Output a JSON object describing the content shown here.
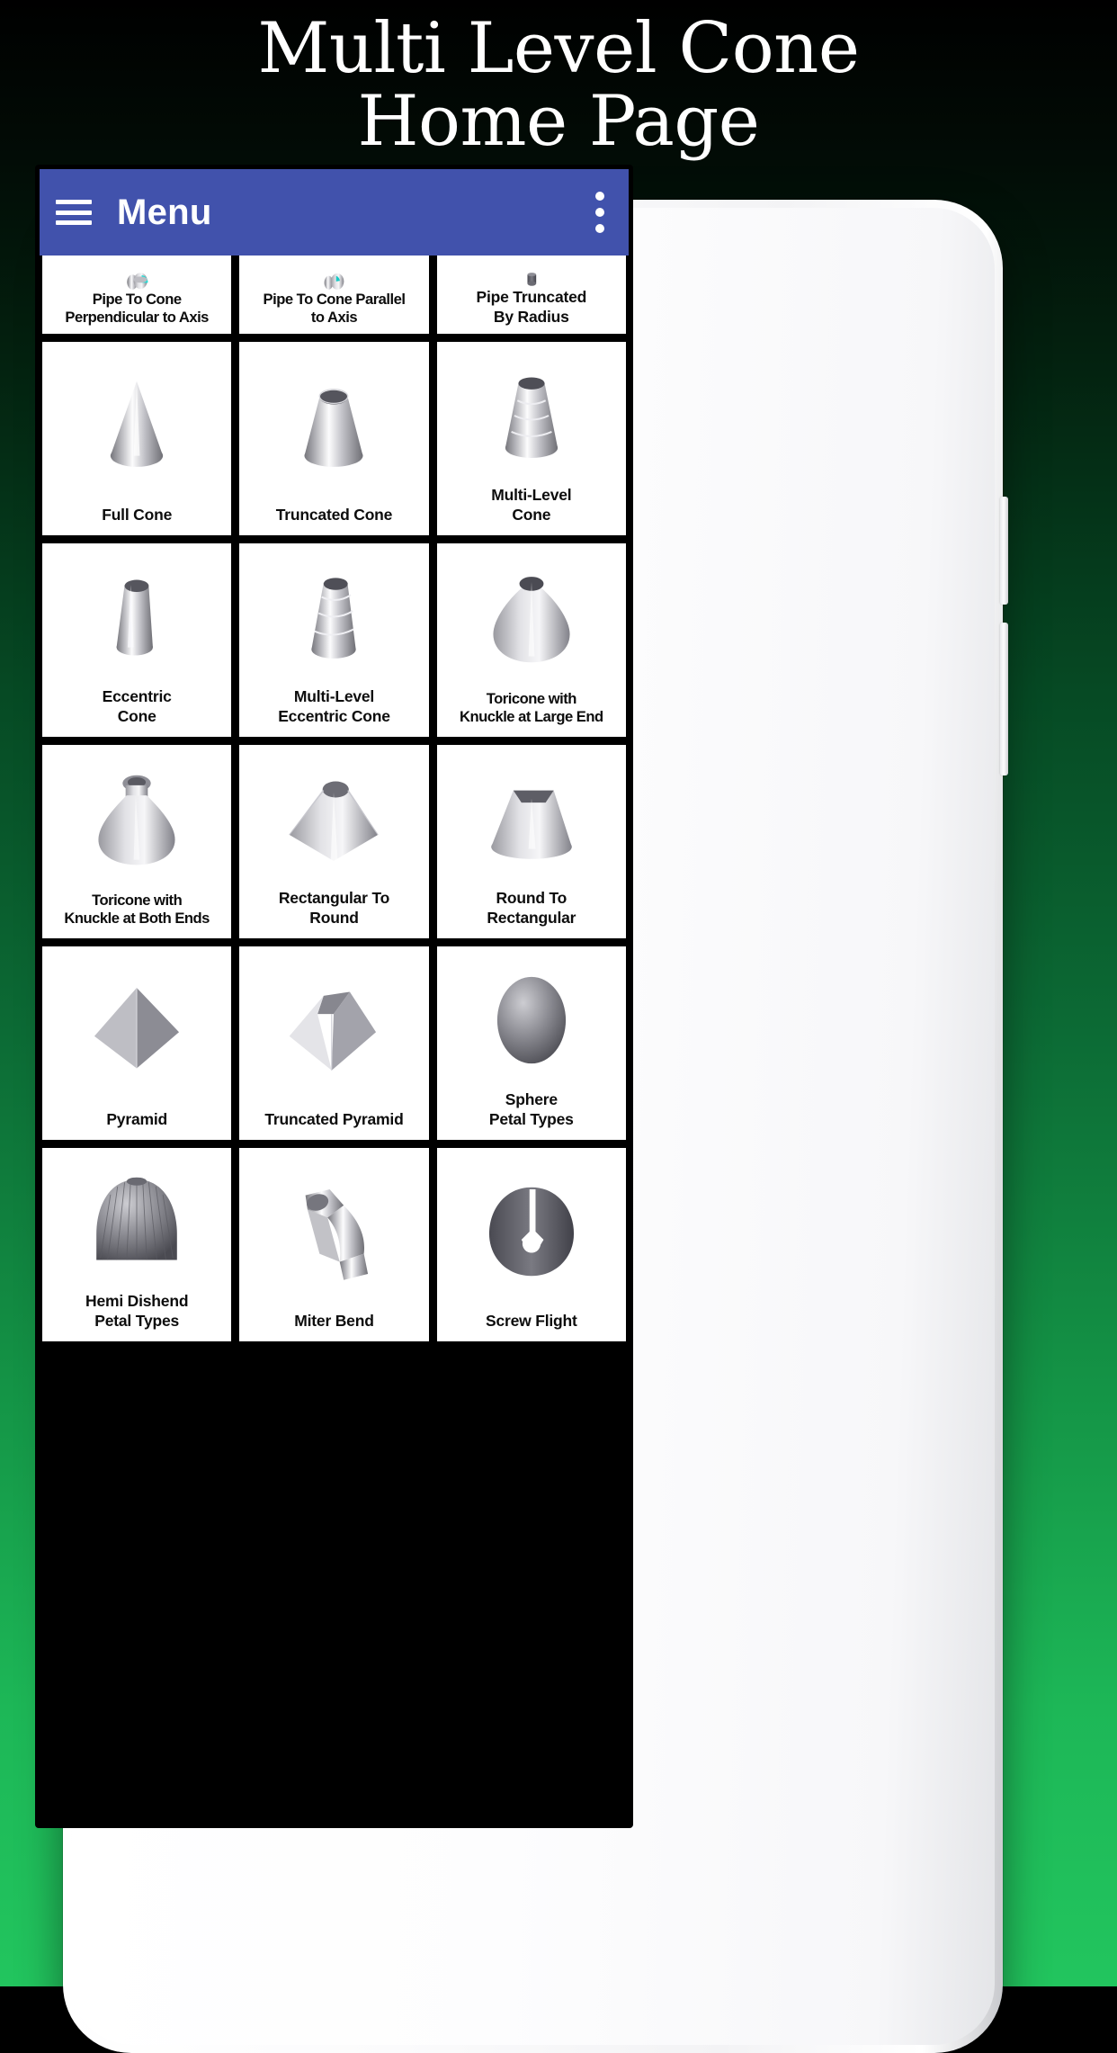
{
  "hero": {
    "line1": "Multi Level Cone",
    "line2": "Home Page"
  },
  "colors": {
    "appbar": "#4152AC",
    "backdrop_top": "#000000",
    "backdrop_bottom": "#22c55e",
    "cell_bg": "#ffffff",
    "grid_gap": "#000000",
    "caption_text": "#0d0d0d"
  },
  "appbar": {
    "menu_icon": "hamburger-icon",
    "title": "Menu",
    "overflow_icon": "three-dots-vertical-icon"
  },
  "grid": {
    "columns": 3,
    "items": [
      {
        "label": "Pipe To Cone\nPerpendicular to Axis",
        "icon": "pipe-to-cone-perpendicular",
        "partial": true
      },
      {
        "label": "Pipe To Cone Parallel\nto Axis",
        "icon": "pipe-to-cone-parallel",
        "partial": true
      },
      {
        "label": "Pipe Truncated\nBy Radius",
        "icon": "pipe-truncated-by-radius",
        "partial": true
      },
      {
        "label": "Full Cone",
        "icon": "full-cone",
        "partial": false
      },
      {
        "label": "Truncated Cone",
        "icon": "truncated-cone",
        "partial": false
      },
      {
        "label": "Multi-Level\nCone",
        "icon": "multi-level-cone",
        "partial": false
      },
      {
        "label": "Eccentric\nCone",
        "icon": "eccentric-cone",
        "partial": false
      },
      {
        "label": "Multi-Level\nEccentric Cone",
        "icon": "multi-level-eccentric-cone",
        "partial": false
      },
      {
        "label": "Toricone with\nKnuckle at Large End",
        "icon": "toricone-knuckle-large-end",
        "partial": false
      },
      {
        "label": "Toricone with\nKnuckle at Both Ends",
        "icon": "toricone-knuckle-both-ends",
        "partial": false
      },
      {
        "label": "Rectangular To\nRound",
        "icon": "rectangular-to-round",
        "partial": false
      },
      {
        "label": "Round To\nRectangular",
        "icon": "round-to-rectangular",
        "partial": false
      },
      {
        "label": "Pyramid",
        "icon": "pyramid",
        "partial": false
      },
      {
        "label": "Truncated Pyramid",
        "icon": "truncated-pyramid",
        "partial": false
      },
      {
        "label": "Sphere\nPetal Types",
        "icon": "sphere-petal-types",
        "partial": false
      },
      {
        "label": "Hemi Dishend\nPetal Types",
        "icon": "hemi-dishend-petal-types",
        "partial": false
      },
      {
        "label": "Miter Bend",
        "icon": "miter-bend",
        "partial": false
      },
      {
        "label": "Screw Flight",
        "icon": "screw-flight",
        "partial": false
      }
    ]
  }
}
